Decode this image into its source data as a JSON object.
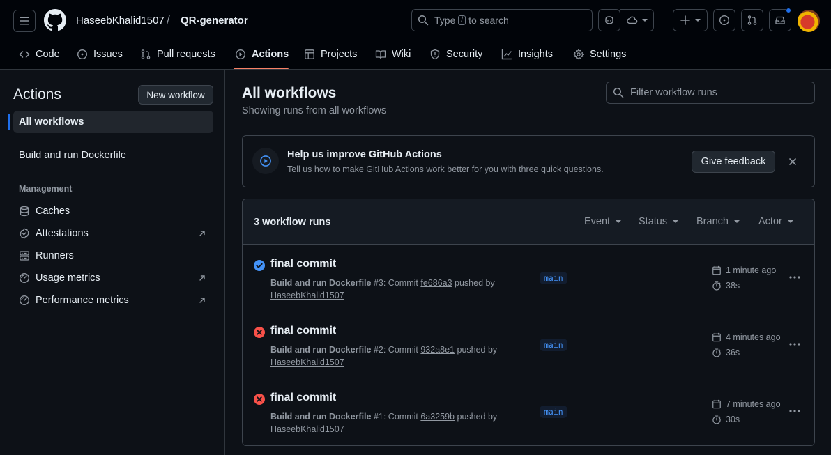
{
  "header": {
    "owner": "HaseebKhalid1507",
    "separator": "/",
    "repo": "QR-generator",
    "search_prefix": "Type",
    "search_key": "/",
    "search_suffix": "to search"
  },
  "tabs": [
    {
      "label": "Code",
      "icon": "code-icon"
    },
    {
      "label": "Issues",
      "icon": "issue-icon"
    },
    {
      "label": "Pull requests",
      "icon": "pull-request-icon"
    },
    {
      "label": "Actions",
      "icon": "play-icon",
      "active": true
    },
    {
      "label": "Projects",
      "icon": "table-icon"
    },
    {
      "label": "Wiki",
      "icon": "book-icon"
    },
    {
      "label": "Security",
      "icon": "shield-icon"
    },
    {
      "label": "Insights",
      "icon": "graph-icon"
    },
    {
      "label": "Settings",
      "icon": "gear-icon"
    }
  ],
  "sidebar": {
    "title": "Actions",
    "new_workflow": "New workflow",
    "all_workflows": "All workflows",
    "workflow": "Build and run Dockerfile",
    "management_heading": "Management",
    "management": [
      {
        "label": "Caches",
        "icon": "database-icon"
      },
      {
        "label": "Attestations",
        "icon": "verified-icon",
        "external": true
      },
      {
        "label": "Runners",
        "icon": "server-icon"
      },
      {
        "label": "Usage metrics",
        "icon": "meter-icon",
        "external": true
      },
      {
        "label": "Performance metrics",
        "icon": "meter-icon",
        "external": true
      }
    ]
  },
  "main": {
    "title": "All workflows",
    "subtitle": "Showing runs from all workflows",
    "filter_placeholder": "Filter workflow runs"
  },
  "banner": {
    "title": "Help us improve GitHub Actions",
    "text": "Tell us how to make GitHub Actions work better for you with three quick questions.",
    "button": "Give feedback"
  },
  "runs": {
    "count_label": "3 workflow runs",
    "filters": [
      "Event",
      "Status",
      "Branch",
      "Actor"
    ],
    "items": [
      {
        "status": "success",
        "title": "final commit",
        "workflow": "Build and run Dockerfile",
        "number": "#3",
        "commit_text": ": Commit",
        "commit": "fe686a3",
        "pushed_by": "pushed by",
        "actor": "HaseebKhalid1507",
        "branch": "main",
        "time": "1 minute ago",
        "duration": "38s"
      },
      {
        "status": "failure",
        "title": "final commit",
        "workflow": "Build and run Dockerfile",
        "number": "#2",
        "commit_text": ": Commit",
        "commit": "932a8e1",
        "pushed_by": "pushed by",
        "actor": "HaseebKhalid1507",
        "branch": "main",
        "time": "4 minutes ago",
        "duration": "36s"
      },
      {
        "status": "failure",
        "title": "final commit",
        "workflow": "Build and run Dockerfile",
        "number": "#1",
        "commit_text": ": Commit",
        "commit": "6a3259b",
        "pushed_by": "pushed by",
        "actor": "HaseebKhalid1507",
        "branch": "main",
        "time": "7 minutes ago",
        "duration": "30s"
      }
    ]
  },
  "colors": {
    "success": "#4493f8",
    "failure": "#f85149",
    "accent": "#f78166"
  }
}
